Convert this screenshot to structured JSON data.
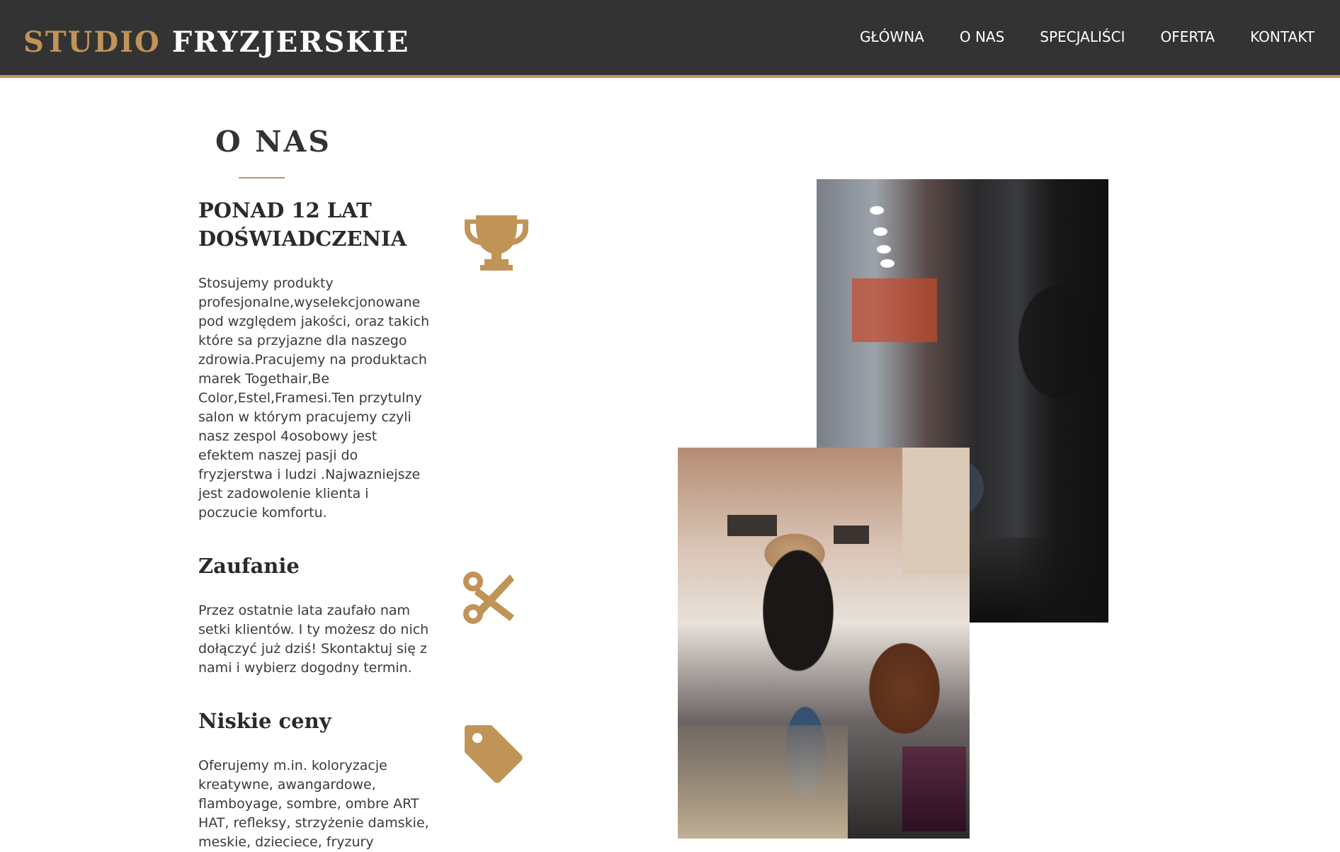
{
  "header": {
    "logo_part1": "STUDIO",
    "logo_part2": "FRYZJERSKIE",
    "nav": [
      "GŁÓWNA",
      "O NAS",
      "SPECJALIŚCI",
      "OFERTA",
      "KONTAKT"
    ]
  },
  "about": {
    "title": "O NAS",
    "features": [
      {
        "title": "PONAD 12 LAT DOŚWIADCZENIA",
        "text": "Stosujemy produkty profesjonalne,wyselekcjonowane pod względem jakości, oraz takich które sa przyjazne dla naszego zdrowia.Pracujemy na produktach marek Togethair,Be Color,Estel,Framesi.Ten przytulny salon w którym pracujemy czyli nasz zespol 4osobowy jest efektem naszej pasji do fryzjerstwa i ludzi .Najwazniejsze jest zadowolenie klienta i poczucie komfortu.",
        "icon": "trophy-icon"
      },
      {
        "title": "Zaufanie",
        "text": "Przez ostatnie lata zaufało nam setki klientów. I ty możesz do nich dołączyć już dziś! Skontaktuj się z nami i wybierz dogodny termin.",
        "icon": "scissors-icon"
      },
      {
        "title": "Niskie ceny",
        "text": "Oferujemy m.in. koloryzacje kreatywne, awangardowe, flamboyage, sombre, ombre ART HAT, refleksy, strzyżenie damskie, meskie, dzieciece, fryzury",
        "icon": "tag-icon"
      }
    ]
  },
  "colors": {
    "accent": "#c09357",
    "header_bg": "#333333",
    "text": "#3a3a3a"
  }
}
